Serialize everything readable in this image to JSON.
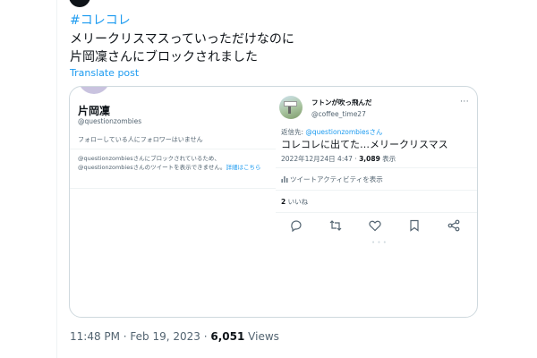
{
  "tweet": {
    "hashtag": "#コレコレ",
    "line1": "メリークリスマスっていっただけなのに",
    "line2": "片岡凜さんにブロックされました",
    "translate": "Translate post",
    "time": "11:48 PM · Feb 19, 2023 · ",
    "views_count": "6,051",
    "views_label": " Views"
  },
  "left_screenshot": {
    "name": "片岡凜",
    "handle": "@questionzombies",
    "follow_text": "フォローしている人にフォロワーはいません",
    "blocked_text_1": "@questionzombiesさんにブロックされているため、",
    "blocked_text_2": "@questionzombiesさんのツイートを表示できません。",
    "blocked_link": "詳細はこちら"
  },
  "right_screenshot": {
    "name": "フトンが吹っ飛んだ",
    "handle": "@coffee_time27",
    "more": "···",
    "reply_prefix": "返信先: ",
    "reply_mention": "@questionzombiesさん",
    "text": "コレコレに出てた…メリークリスマス",
    "date": "2022年12月24日 4:47 · ",
    "views_count": "3,089",
    "views_label": " 表示",
    "activity": "ツイートアクティビティを表示",
    "likes_count": "2",
    "likes_label": " いいね",
    "dots": "• • •"
  }
}
